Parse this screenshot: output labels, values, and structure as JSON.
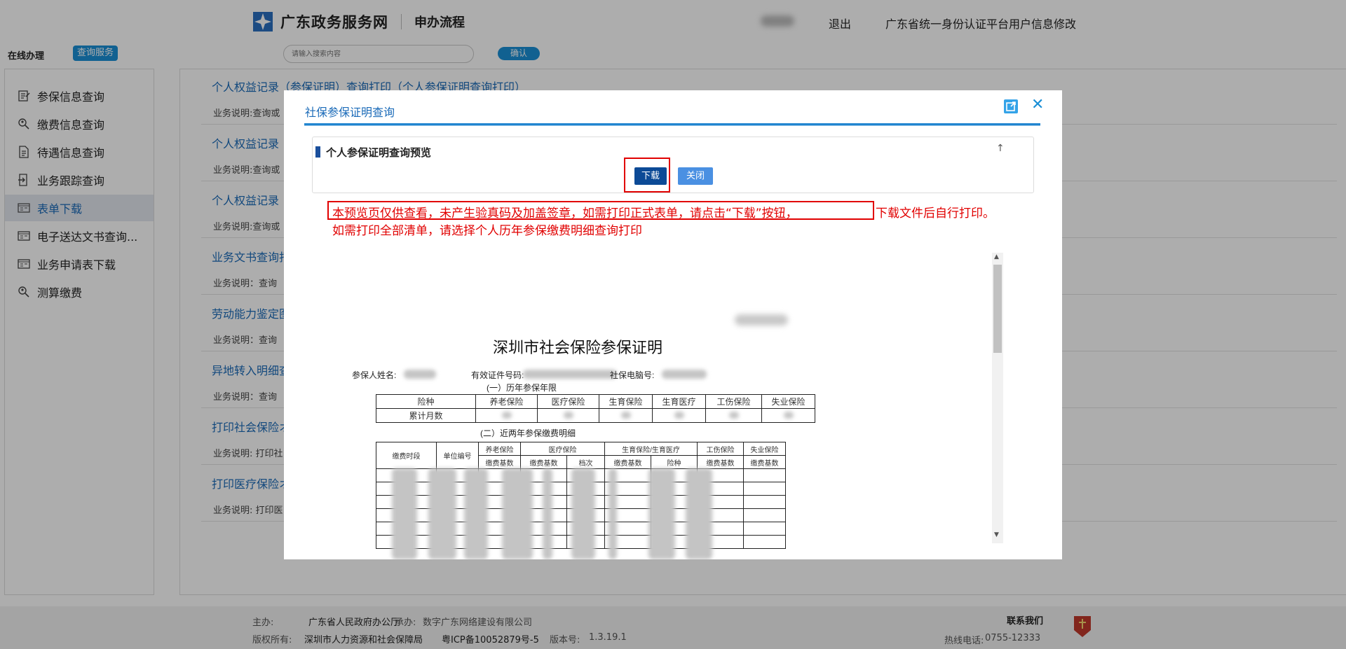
{
  "header": {
    "site_name": "广东政务服务网",
    "section": "申办流程",
    "logout": "退出",
    "profile_link": "广东省统一身份认证平台用户信息修改"
  },
  "toolbar": {
    "online": "在线办理",
    "query_tab": "查询服务",
    "search_placeholder": "请输入搜索内容",
    "confirm": "确认"
  },
  "sidebar": {
    "items": [
      {
        "label": "参保信息查询",
        "icon": "edit-icon",
        "active": false
      },
      {
        "label": "缴费信息查询",
        "icon": "search-person-icon",
        "active": false
      },
      {
        "label": "待遇信息查询",
        "icon": "document-icon",
        "active": false
      },
      {
        "label": "业务跟踪查询",
        "icon": "track-icon",
        "active": false
      },
      {
        "label": "表单下载",
        "icon": "form-icon",
        "active": true
      },
      {
        "label": "电子送达文书查询...",
        "icon": "form-icon",
        "active": false
      },
      {
        "label": "业务申请表下载",
        "icon": "form-icon",
        "active": false
      },
      {
        "label": "测算缴费",
        "icon": "search-person-icon",
        "active": false
      }
    ]
  },
  "main": {
    "items": [
      {
        "title": "个人权益记录（参保证明）查询打印（个人参保证明查询打印）",
        "desc": "业务说明:查询或"
      },
      {
        "title": "个人权益记录",
        "desc": "业务说明:查询或"
      },
      {
        "title": "个人权益记录",
        "desc": "业务说明:查询或"
      },
      {
        "title": "业务文书查询打",
        "desc": "业务说明：查询"
      },
      {
        "title": "劳动能力鉴定图",
        "desc": "业务说明：查询"
      },
      {
        "title": "异地转入明细查",
        "desc": "业务说明：查询"
      },
      {
        "title": "打印社会保险オ",
        "desc": "业务说明: 打印社"
      },
      {
        "title": "打印医疗保险オ",
        "desc": "业务说明: 打印医"
      }
    ]
  },
  "modal": {
    "title": "社保参保证明查询",
    "preview_title": "个人参保证明查询预览",
    "download": "下载",
    "close": "关闭",
    "notice_boxed": "本预览页仅供查看，未产生验真码及加盖签章，如需打印正式表单，请点击“下载”按钮，",
    "notice_tail": "下载文件后自行打印。",
    "notice_2": "如需打印全部清单，请选择个人历年参保缴费明细查询打印"
  },
  "document": {
    "title": "深圳市社会保险参保证明",
    "name_label": "参保人姓名:",
    "id_label": "有效证件号码:",
    "computer_no_label": "社保电脑号:",
    "section1": "(一）历年参保年限",
    "table1_headers": [
      "险种",
      "养老保险",
      "医疗保险",
      "生育保险",
      "生育医疗",
      "工伤保险",
      "失业保险"
    ],
    "table1_row_label": "累计月数",
    "section2": "(二）近两年参保缴费明细",
    "table2_headers_top": [
      "缴费时段",
      "单位编号",
      "养老保险",
      "医疗保险",
      "生育保险/生育医疗",
      "工伤保险",
      "失业保险"
    ],
    "table2_headers_sub": [
      "缴费基数",
      "缴费基数",
      "档次",
      "缴费基数",
      "险种",
      "缴费基数",
      "缴费基数"
    ]
  },
  "footer": {
    "host_label": "主办:",
    "host": "广东省人民政府办公厅",
    "org_label": "承办:",
    "org": "数字广东网络建设有限公司",
    "copyright_label": "版权所有:",
    "copyright": "深圳市人力资源和社会保障局",
    "icp": "粤ICP备10052879号-5",
    "version_label": "版本号:",
    "version": "1.3.19.1",
    "contact": "联系我们",
    "hotline_label": "热线电话:",
    "hotline": "0755-12333"
  },
  "colors": {
    "brand_blue": "#1a8fd6",
    "link_blue": "#1a6ab8",
    "alert_red": "#e10000",
    "download_navy": "#0c4a96"
  }
}
